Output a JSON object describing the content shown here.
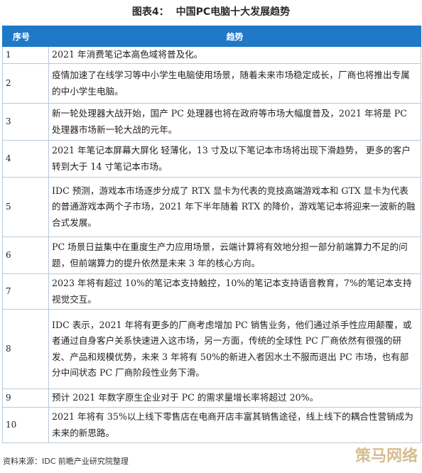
{
  "figure": {
    "label": "图表4：",
    "title": "中国PC电脑十大发展趋势"
  },
  "table": {
    "headers": [
      "序号",
      "趋势"
    ],
    "rows": [
      {
        "no": "1",
        "text": "2021 年消费笔记本高色域将普及化。"
      },
      {
        "no": "2",
        "text": "疫情加速了在线学习等中小学生电脑使用场景，随着未来市场稳定成长，厂商也将推出专属的中小学生电脑。"
      },
      {
        "no": "3",
        "text": "新一轮处理器大战开始，国产 PC 处理器也将在政府等市场大幅度普及，2021 年将是 PC 处理器市场新一轮大战的元年。"
      },
      {
        "no": "4",
        "text": "2021 年笔记本屏幕大屏化 轻薄化，13 寸及以下笔记本市场将出现下滑趋势， 更多的客户转到大于 14 寸笔记本市场。"
      },
      {
        "no": "5",
        "text": "IDC 预测，游戏本市场逐步分成了 RTX 显卡为代表的竞技高端游戏本和 GTX 显卡为代表的普通游戏本两个子市场，2021 年下半年随着 RTX 的降价，游戏笔记本将迎来一波新的融合式发展。"
      },
      {
        "no": "6",
        "text": "PC 场景日益集中在重度生产力应用场景，云端计算将有效地分担一部分前端算力不足的问题，但前端算力的提升依然是未来 3 年的核心方向。"
      },
      {
        "no": "7",
        "text": "2023 年将有超过 10%的笔记本支持触控，10%的笔记本支持语音教育，7%的笔记本支持视觉交互。"
      },
      {
        "no": "8",
        "text": "IDC 表示，2021 年将有更多的厂商考虑增加 PC 销售业务，他们通过杀手性应用颠覆，或者通过自身客户关系快速进入这市场，另一方面，传统的全球性 PC 厂商依然有很强的研发、产品和规模优势，未来 3 年将有 50%的新进入者因水土不服而退出 PC 市场，也有部分中间状态 PC 厂商阶段性业务下滑。"
      },
      {
        "no": "9",
        "text": "预计 2021 年数字原生企业对于 PC 的需求量增长率将超过 20%。"
      },
      {
        "no": "10",
        "text": "2021 年将有 35%以上线下零售店在电商开店丰富其销售途径，线上线下的耦合性营销成为未来的新思路。"
      }
    ]
  },
  "source": "资料来源：IDC 前瞻产业研究院整理",
  "watermark": "策马网络"
}
